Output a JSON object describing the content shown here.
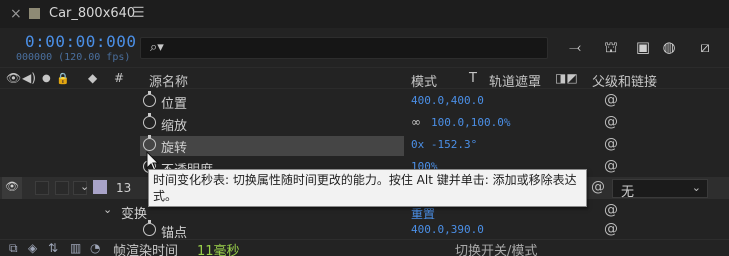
{
  "tab": {
    "close_icon": "×",
    "name": "Car_800x640",
    "menu_icon": "☰",
    "swatch_color": "#8e8a75"
  },
  "timeline": {
    "timecode": "0:00:00:000",
    "frames": "000000 (120.00 fps)"
  },
  "search": {
    "icon": "⌕▾",
    "value": ""
  },
  "toolbar": [
    {
      "name": "graph-toggle-icon",
      "glyph": "⤙"
    },
    {
      "name": "draft-3d-icon",
      "glyph": "⛫"
    },
    {
      "name": "frame-blend-icon",
      "glyph": "▣"
    },
    {
      "name": "motion-blur-icon",
      "glyph": "◍"
    },
    {
      "name": "graph-editor-icon",
      "glyph": "⧄"
    }
  ],
  "header": {
    "source_name": "源名称",
    "mode": "模式",
    "t": "T",
    "track_matte": "轨道遮罩",
    "parent_link": "父级和链接"
  },
  "properties": [
    {
      "name": "位置",
      "value": "400.0,400.0",
      "link": ""
    },
    {
      "name": "缩放",
      "value": "100.0,100.0%",
      "link": "∞"
    },
    {
      "name": "旋转",
      "value": "0x -152.3°",
      "link": ""
    },
    {
      "name": "不透明度",
      "value": "100%",
      "link": ""
    }
  ],
  "layer": {
    "number": "13",
    "parent_value": "无",
    "swatch_color": "#a8a3c8"
  },
  "transform": {
    "label": "变换",
    "reset": "重置"
  },
  "anchor": {
    "name": "锚点",
    "value": "400.0,390.0"
  },
  "tooltip": {
    "text": "时间变化秒表: 切换属性随时间更改的能力。按住 Alt 键并单击: 添加或移除表达式。"
  },
  "bottom": {
    "frame_time_label": "帧渲染时间",
    "frame_time_value": "11毫秒",
    "toggle_mode": "切换开关/模式"
  }
}
